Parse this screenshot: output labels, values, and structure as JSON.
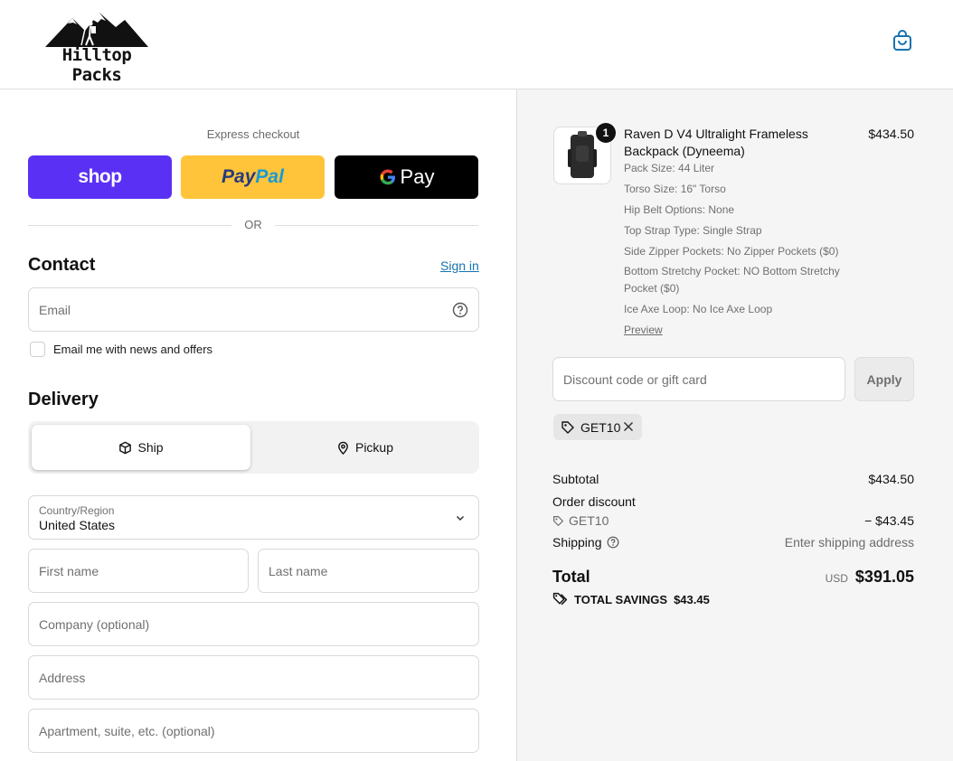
{
  "header": {
    "brand": "Hilltop Packs",
    "cart_icon": "shopping-bag-icon"
  },
  "express": {
    "label": "Express checkout",
    "shop_label": "shop",
    "paypal_label_1": "Pay",
    "paypal_label_2": "Pal",
    "gpay_label": "Pay",
    "or": "OR"
  },
  "contact": {
    "title": "Contact",
    "signin": "Sign in",
    "email_placeholder": "Email",
    "news_label": "Email me with news and offers"
  },
  "delivery": {
    "title": "Delivery",
    "ship_label": "Ship",
    "pickup_label": "Pickup",
    "country_label": "Country/Region",
    "country_value": "United States",
    "first_name": "First name",
    "last_name": "Last name",
    "company": "Company (optional)",
    "address": "Address",
    "apartment": "Apartment, suite, etc. (optional)"
  },
  "product": {
    "quantity": "1",
    "title": "Raven D V4 Ultralight Frameless Backpack (Dyneema)",
    "price": "$434.50",
    "options": [
      "Pack Size: 44 Liter",
      "Torso Size: 16\" Torso",
      "Hip Belt Options: None",
      "Top Strap Type: Single Strap",
      "Side Zipper Pockets: No Zipper Pockets ($0)",
      "Bottom Stretchy Pocket: NO Bottom Stretchy Pocket ($0)",
      "Ice Axe Loop: No Ice Axe Loop"
    ],
    "preview": "Preview"
  },
  "discount": {
    "placeholder": "Discount code or gift card",
    "apply": "Apply",
    "code": "GET10"
  },
  "summary": {
    "subtotal_label": "Subtotal",
    "subtotal_value": "$434.50",
    "order_discount_label": "Order discount",
    "discount_code": "GET10",
    "discount_value": "− $43.45",
    "shipping_label": "Shipping",
    "shipping_value": "Enter shipping address",
    "total_label": "Total",
    "currency": "USD",
    "total_value": "$391.05",
    "savings_label": "TOTAL SAVINGS",
    "savings_value": "$43.45"
  },
  "colors": {
    "shop": "#5a31f4",
    "paypal": "#ffc439",
    "gpay": "#000000",
    "link": "#1773b0"
  }
}
